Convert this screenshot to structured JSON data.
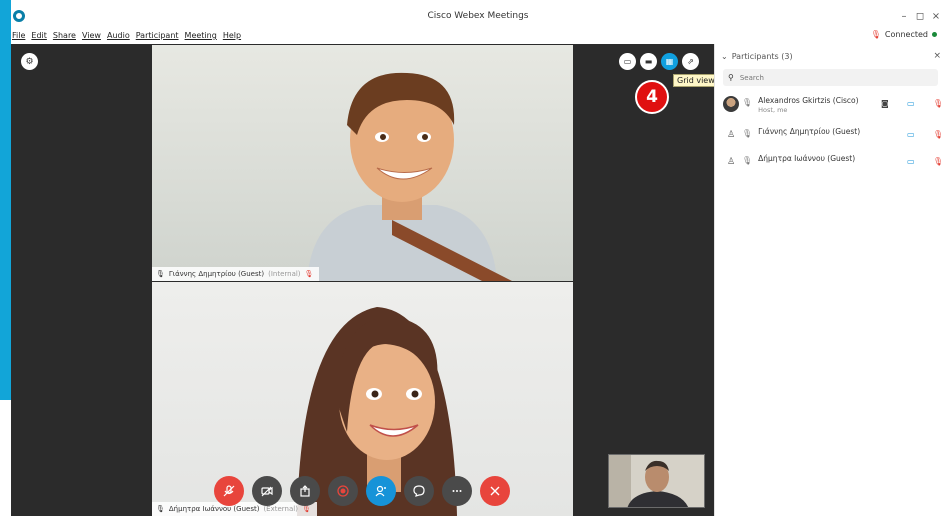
{
  "window": {
    "title": "Cisco Webex Meetings",
    "minimize": "–",
    "maximize": "◻",
    "close": "×"
  },
  "menu": [
    "File",
    "Edit",
    "Share",
    "View",
    "Audio",
    "Participant",
    "Meeting",
    "Help"
  ],
  "status": {
    "label": "Connected"
  },
  "stage": {
    "tiles": [
      {
        "name": "Γιάννης Δημητρίου (Guest)",
        "tag": "(Internal)"
      },
      {
        "name": "Δήμητρα Ιωάννου (Guest)",
        "tag": "(External)"
      }
    ],
    "tooltip": "Grid view",
    "step_badge": "4"
  },
  "panel": {
    "title": "Participants (3)",
    "search_placeholder": "Search",
    "participants": [
      {
        "name": "Alexandros Gkirtzis (Cisco)",
        "sub": "Host, me"
      },
      {
        "name": "Γιάννης Δημητρίου (Guest)",
        "sub": ""
      },
      {
        "name": "Δήμητρα Ιωάννου (Guest)",
        "sub": ""
      }
    ]
  },
  "colors": {
    "accent": "#10a0df",
    "end_call": "#e8453c",
    "badge": "#e01010",
    "connected": "#1b8a3a"
  },
  "icons": [
    "webex-logo-icon",
    "gear-icon",
    "picture-in-picture-icon",
    "stage-view-icon",
    "grid-view-icon",
    "pop-out-icon",
    "mute-icon",
    "video-icon",
    "share-icon",
    "record-icon",
    "participants-icon",
    "chat-icon",
    "more-icon",
    "leave-icon",
    "search-icon",
    "chevron-down-icon"
  ]
}
